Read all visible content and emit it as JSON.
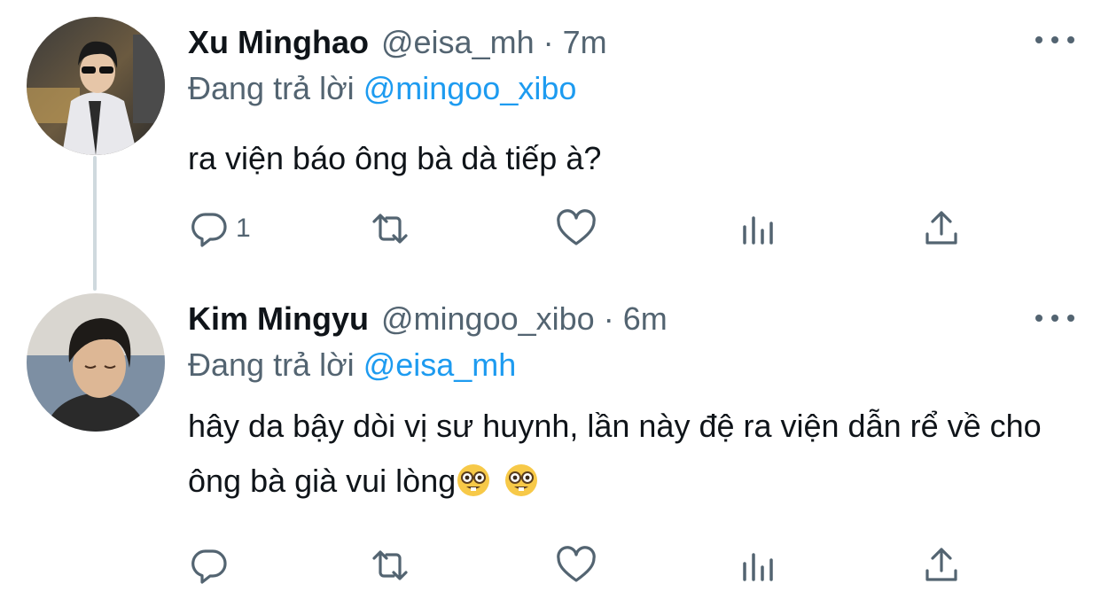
{
  "tweets": [
    {
      "display_name": "Xu Minghao",
      "handle": "@eisa_mh",
      "separator": "·",
      "time": "7m",
      "reply_prefix": "Đang trả lời",
      "reply_mention": "@mingoo_xibo",
      "text": "ra viện báo ông bà dà tiếp à?",
      "reply_count": "1"
    },
    {
      "display_name": "Kim Mingyu",
      "handle": "@mingoo_xibo",
      "separator": "·",
      "time": "6m",
      "reply_prefix": "Đang trả lời",
      "reply_mention": "@eisa_mh",
      "text": "hây da bậy dòi vị sư huynh, lần này đệ ra viện dẫn rể về cho ông bà già vui lòng",
      "emojis": [
        "nerd-face-emoji",
        "nerd-face-emoji"
      ],
      "reply_count": ""
    }
  ],
  "icons": [
    "reply-icon",
    "retweet-icon",
    "like-icon",
    "analytics-icon",
    "share-icon",
    "more-icon"
  ],
  "colors": {
    "text": "#0f1419",
    "secondary": "#536471",
    "accent": "#1d9bf0",
    "thread_line": "#cfd9de"
  }
}
